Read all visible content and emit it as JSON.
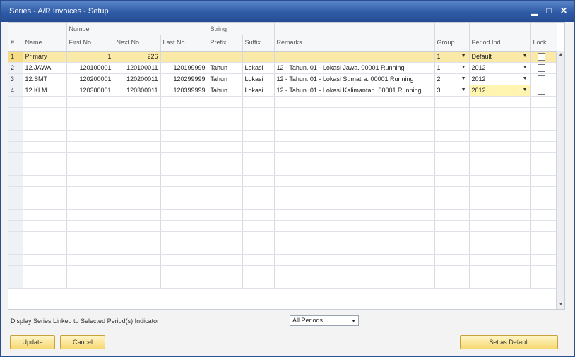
{
  "window": {
    "title": "Series - A/R Invoices - Setup"
  },
  "grid": {
    "group_headers": {
      "number": "Number",
      "string": "String"
    },
    "columns": {
      "index": "#",
      "name": "Name",
      "first_no": "First No.",
      "next_no": "Next No.",
      "last_no": "Last No.",
      "prefix": "Prefix",
      "suffix": "Suffix",
      "remarks": "Remarks",
      "group": "Group",
      "period_ind": "Period Ind.",
      "lock": "Lock"
    },
    "rows": [
      {
        "index": "1",
        "name": "Primary",
        "first_no": "1",
        "next_no": "226",
        "last_no": "",
        "prefix": "",
        "suffix": "",
        "remarks": "",
        "group": "1",
        "period_ind": "Default",
        "locked": false
      },
      {
        "index": "2",
        "name": "12.JAWA",
        "first_no": "120100001",
        "next_no": "120100011",
        "last_no": "120199999",
        "prefix": "Tahun",
        "suffix": "Lokasi",
        "remarks": "12 - Tahun. 01 - Lokasi Jawa. 00001 Running",
        "group": "1",
        "period_ind": "2012",
        "locked": false
      },
      {
        "index": "3",
        "name": "12.SMT",
        "first_no": "120200001",
        "next_no": "120200011",
        "last_no": "120299999",
        "prefix": "Tahun",
        "suffix": "Lokasi",
        "remarks": "12 - Tahun. 01 - Lokasi Sumatra. 00001 Running",
        "group": "2",
        "period_ind": "2012",
        "locked": false
      },
      {
        "index": "4",
        "name": "12.KLM",
        "first_no": "120300001",
        "next_no": "120300011",
        "last_no": "120399999",
        "prefix": "Tahun",
        "suffix": "Lokasi",
        "remarks": "12 - Tahun. 01 - Lokasi Kalimantan. 00001 Running",
        "group": "3",
        "period_ind": "2012",
        "locked": false
      }
    ]
  },
  "footer": {
    "period_filter_label": "Display Series Linked to Selected Period(s) Indicator",
    "period_filter_value": "All Periods",
    "update_label": "Update",
    "cancel_label": "Cancel",
    "set_default_label": "Set as Default"
  },
  "colors": {
    "titlebar": "#2f5ba6",
    "selected_row": "#fbe9a8",
    "button": "#f7d974"
  }
}
